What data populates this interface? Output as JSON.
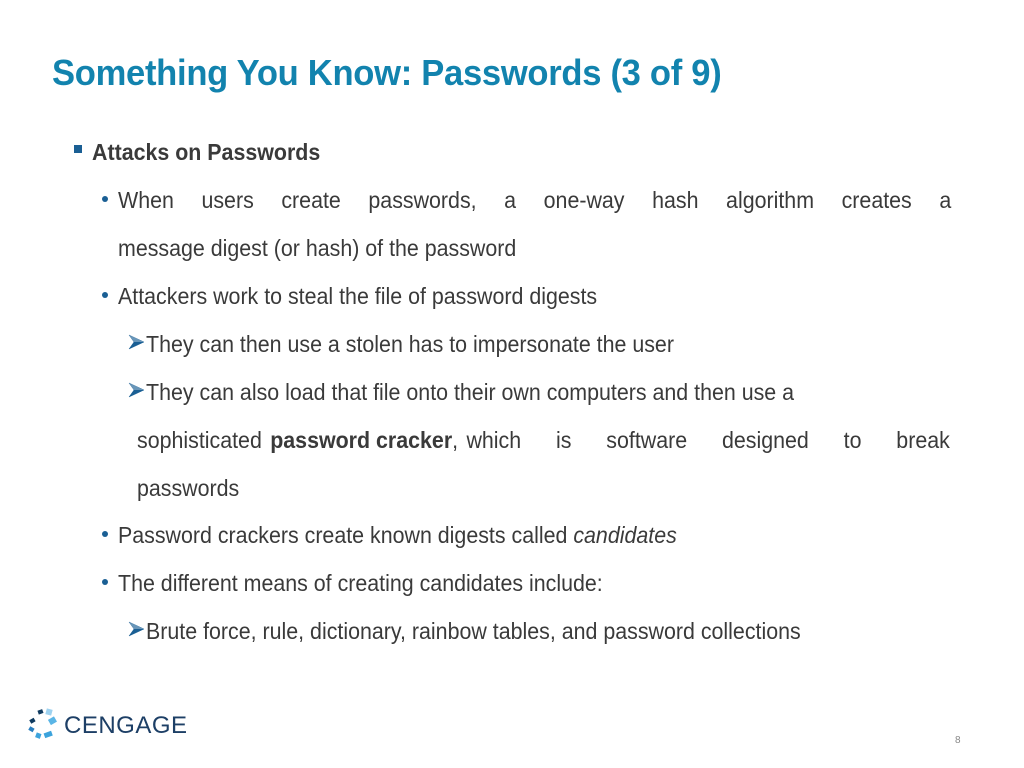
{
  "slide": {
    "title": "Something You Know: Passwords (3 of 9)",
    "page_number": "8",
    "logo_text": "CENGAGE",
    "accent_color": "#1283ae",
    "bullet_color": "#1a5f94"
  },
  "content": {
    "heading": "Attacks on Passwords",
    "bullet1_line1_words": [
      "When",
      "users",
      "create",
      "passwords,",
      "a",
      "one-way",
      "hash",
      "algorithm",
      "creates",
      "a"
    ],
    "bullet1_line2": "message digest (or hash) of the password",
    "bullet2": "Attackers work to steal the file of password digests",
    "sub1": "They can then use a stolen has to impersonate the user",
    "sub2_line1": "They can also load that file onto their own computers and then use a",
    "sub2_line2_pre": "sophisticated",
    "sub2_line2_bold": "password cracker",
    "sub2_line2_post": ", which is software designed to break",
    "sub2_line3": "passwords",
    "bullet3_pre": "Password crackers create known digests called ",
    "bullet3_italic": "candidates",
    "bullet4": "The different means of creating candidates include:",
    "sub3": "Brute force, rule, dictionary, rainbow tables, and password collections"
  },
  "icons": {
    "level1_bullet": "square-bullet-icon",
    "level2_bullet": "dot-bullet-icon",
    "level3_bullet": "arrow-bullet-icon",
    "logo": "cengage-logo-icon"
  }
}
